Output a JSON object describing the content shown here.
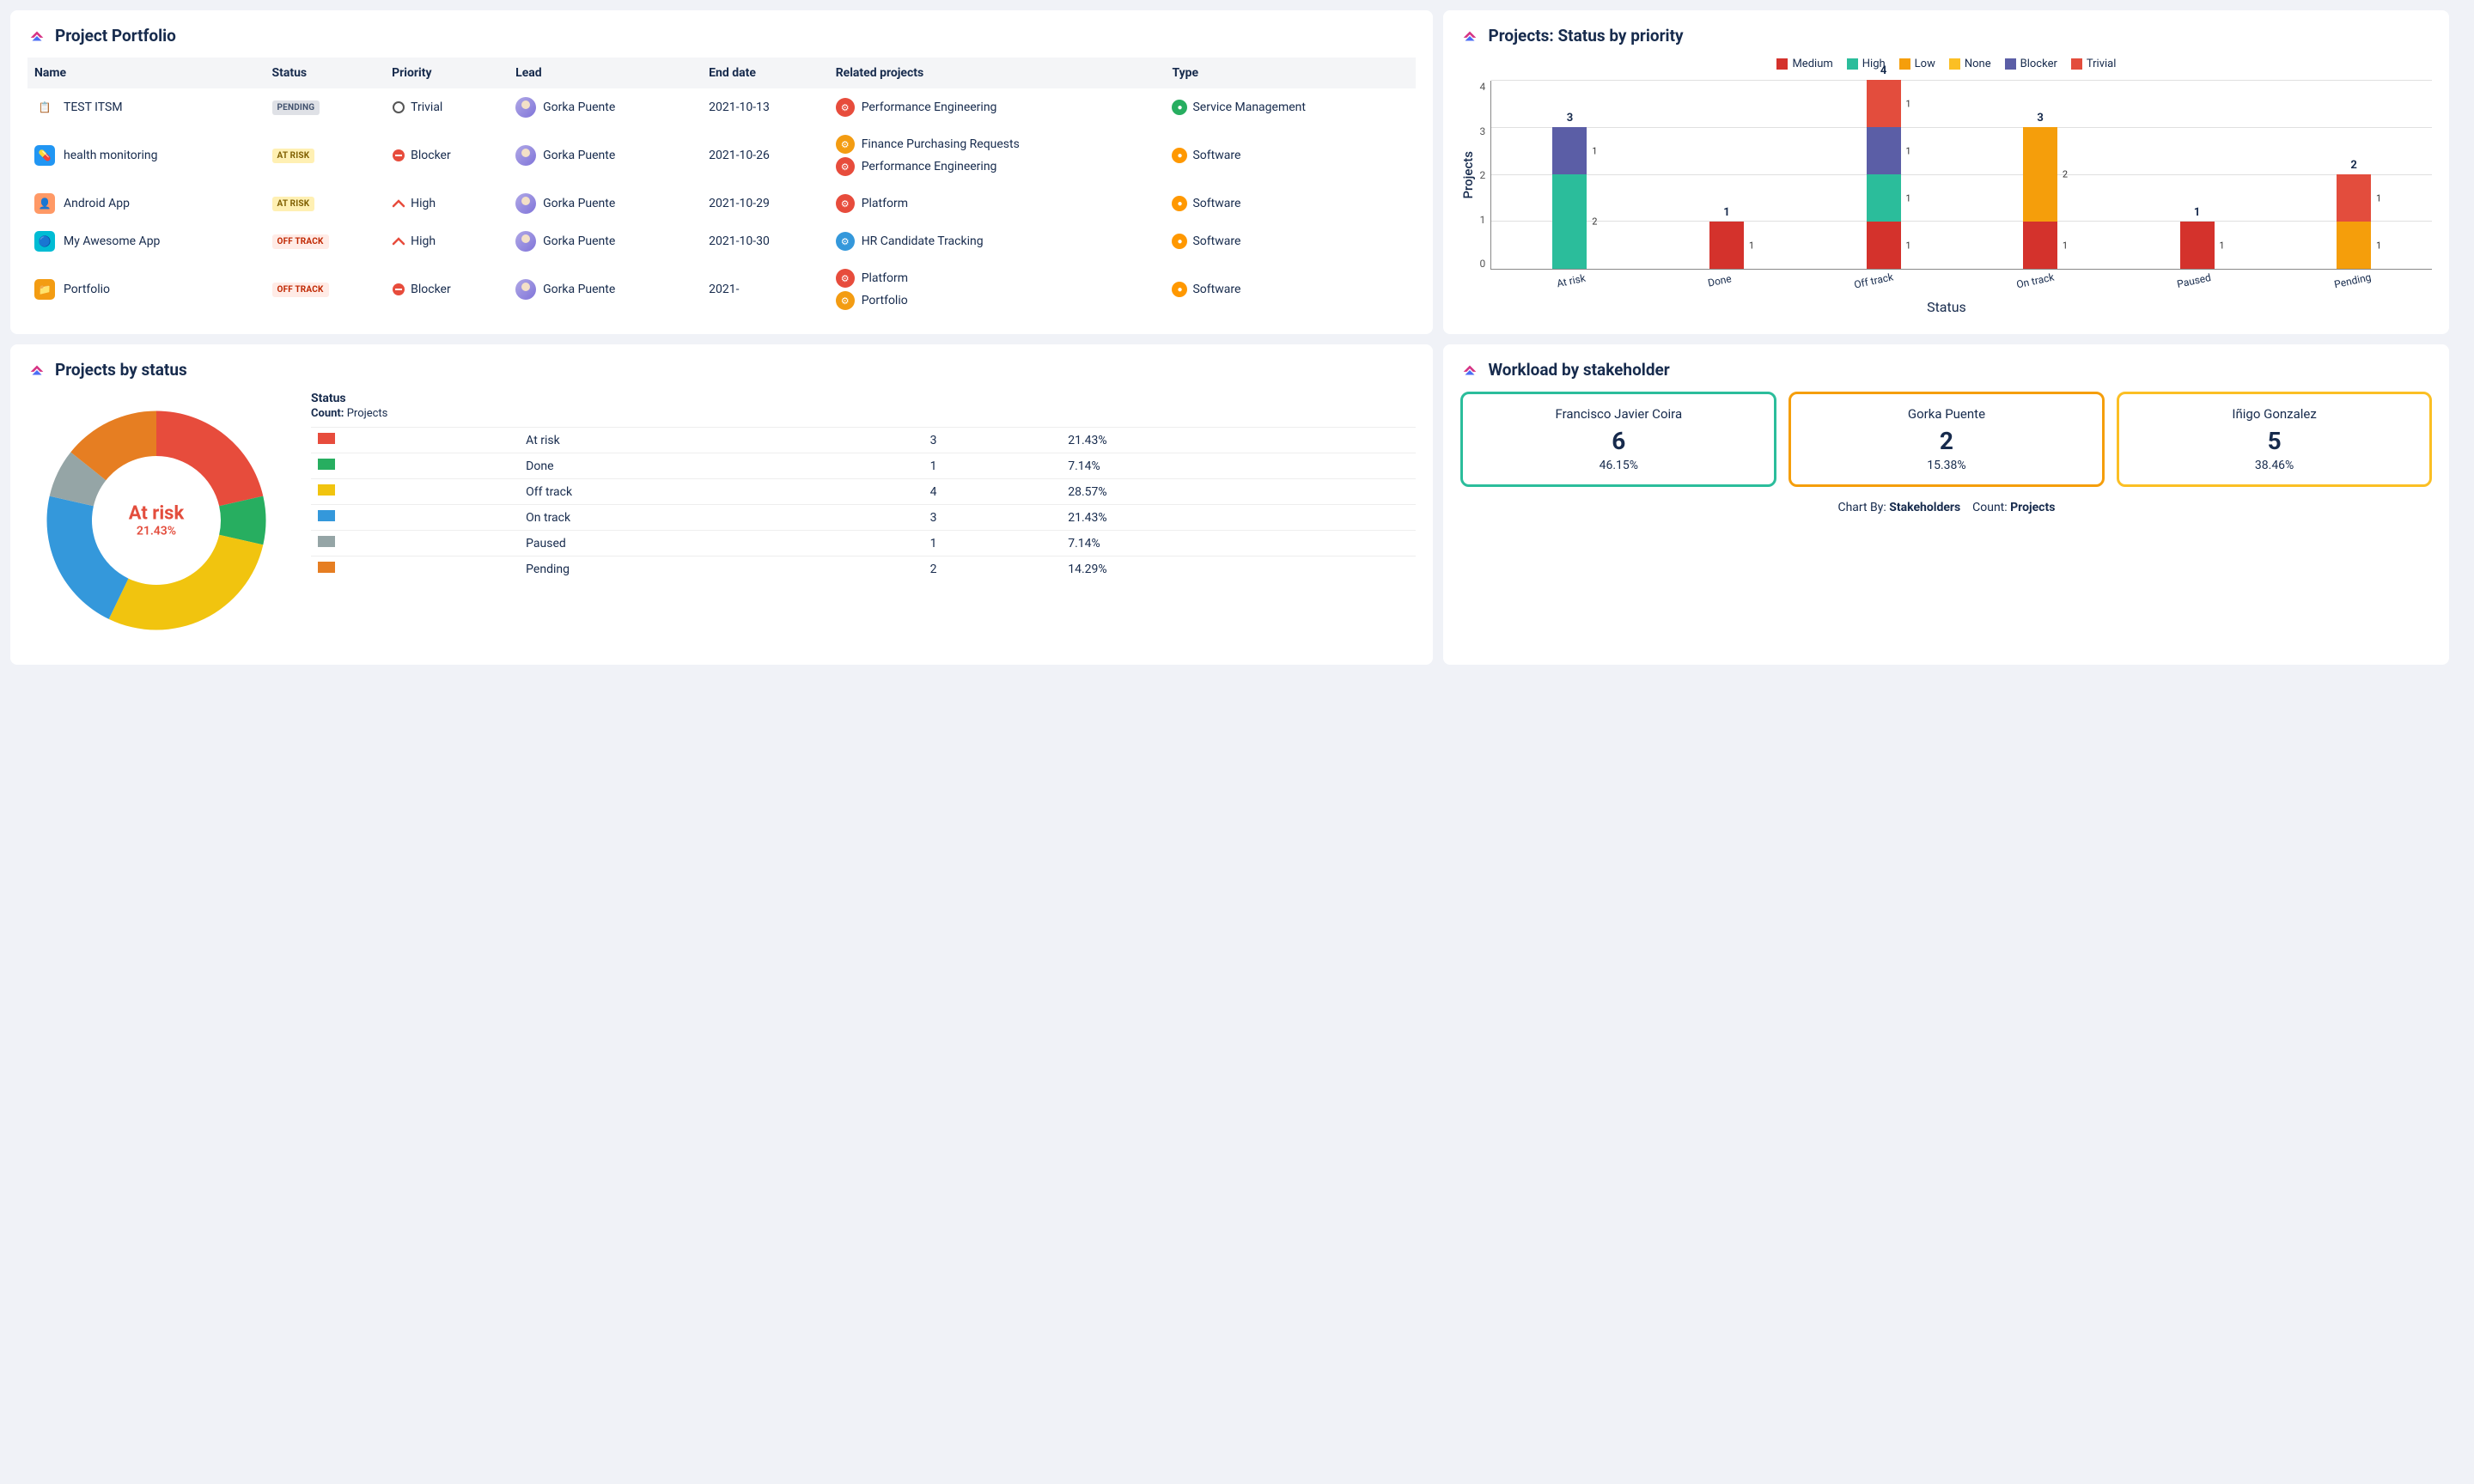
{
  "colors": {
    "medium": "#d4322c",
    "high": "#2bbd9b",
    "low": "#f59e0b",
    "none": "#fbbf24",
    "blocker": "#5b5ea6",
    "trivial": "#e34d3d",
    "pieAtrisk": "#e74c3c",
    "pieDone": "#27ae60",
    "pieOfftrack": "#f1c40f",
    "pieOntrack": "#3498db",
    "piePaused": "#95a5a6",
    "piePending": "#e67e22"
  },
  "portfolio": {
    "title": "Project Portfolio",
    "columns": [
      "Name",
      "Status",
      "Priority",
      "Lead",
      "End date",
      "Related projects",
      "Type"
    ],
    "rows": [
      {
        "icon_bg": "#fff",
        "icon_emoji": "📋",
        "name": "TEST ITSM",
        "status": "PENDING",
        "status_cls": "status-pending",
        "priority": "Trivial",
        "pri_icon": "circle",
        "lead": "Gorka Puente",
        "end": "2021-10-13",
        "related": [
          {
            "icon_bg": "#e74c3c",
            "label": "Performance Engineering"
          }
        ],
        "type": "Service Management",
        "type_bg": "#27ae60"
      },
      {
        "icon_bg": "#2196f3",
        "icon_emoji": "💊",
        "name": "health monitoring",
        "status": "AT RISK",
        "status_cls": "status-atrisk",
        "priority": "Blocker",
        "pri_icon": "blocker",
        "lead": "Gorka Puente",
        "end": "2021-10-26",
        "related": [
          {
            "icon_bg": "#f39c12",
            "label": "Finance Purchasing Requests"
          },
          {
            "icon_bg": "#e74c3c",
            "label": "Performance Engineering"
          }
        ],
        "type": "Software",
        "type_bg": "#ff9800"
      },
      {
        "icon_bg": "#ff9966",
        "icon_emoji": "👤",
        "name": "Android App",
        "status": "AT RISK",
        "status_cls": "status-atrisk",
        "priority": "High",
        "pri_icon": "high",
        "lead": "Gorka Puente",
        "end": "2021-10-29",
        "related": [
          {
            "icon_bg": "#e74c3c",
            "label": "Platform"
          }
        ],
        "type": "Software",
        "type_bg": "#ff9800"
      },
      {
        "icon_bg": "#00bcd4",
        "icon_emoji": "🔵",
        "name": "My Awesome App",
        "status": "OFF TRACK",
        "status_cls": "status-offtrack",
        "priority": "High",
        "pri_icon": "high",
        "lead": "Gorka Puente",
        "end": "2021-10-30",
        "related": [
          {
            "icon_bg": "#3498db",
            "label": "HR Candidate Tracking"
          }
        ],
        "type": "Software",
        "type_bg": "#ff9800"
      },
      {
        "icon_bg": "#f39c12",
        "icon_emoji": "📁",
        "name": "Portfolio",
        "status": "OFF TRACK",
        "status_cls": "status-offtrack",
        "priority": "Blocker",
        "pri_icon": "blocker",
        "lead": "Gorka Puente",
        "end": "2021-",
        "related": [
          {
            "icon_bg": "#e74c3c",
            "label": "Platform"
          },
          {
            "icon_bg": "#f39c12",
            "label": "Portfolio"
          }
        ],
        "type": "Software",
        "type_bg": "#ff9800"
      }
    ]
  },
  "statusByPriority": {
    "title": "Projects: Status by priority",
    "legend": [
      "Medium",
      "High",
      "Low",
      "None",
      "Blocker",
      "Trivial"
    ],
    "ylabel": "Projects",
    "xlabel": "Status",
    "ymax": 4,
    "categories": [
      "At risk",
      "Done",
      "Off track",
      "On track",
      "Paused",
      "Pending"
    ],
    "stacks": [
      {
        "total": 3,
        "segs": [
          {
            "k": "High",
            "v": 2
          },
          {
            "k": "Blocker",
            "v": 1
          }
        ]
      },
      {
        "total": 1,
        "segs": [
          {
            "k": "Medium",
            "v": 1
          }
        ]
      },
      {
        "total": 4,
        "segs": [
          {
            "k": "Medium",
            "v": 1
          },
          {
            "k": "High",
            "v": 1
          },
          {
            "k": "Blocker",
            "v": 1
          },
          {
            "k": "Trivial",
            "v": 1
          }
        ]
      },
      {
        "total": 3,
        "segs": [
          {
            "k": "Medium",
            "v": 1
          },
          {
            "k": "Low",
            "v": 2
          }
        ]
      },
      {
        "total": 1,
        "segs": [
          {
            "k": "Medium",
            "v": 1
          }
        ]
      },
      {
        "total": 2,
        "segs": [
          {
            "k": "Low",
            "v": 1
          },
          {
            "k": "Trivial",
            "v": 1
          }
        ]
      }
    ]
  },
  "projectsByStatus": {
    "title": "Projects by status",
    "center_label": "At risk",
    "center_pct": "21.43%",
    "legend_title": "Status",
    "legend_sub_label": "Count:",
    "legend_sub_value": "Projects",
    "rows": [
      {
        "k": "At risk",
        "count": 3,
        "pct": "21.43%",
        "color": "pieAtrisk"
      },
      {
        "k": "Done",
        "count": 1,
        "pct": "7.14%",
        "color": "pieDone"
      },
      {
        "k": "Off track",
        "count": 4,
        "pct": "28.57%",
        "color": "pieOfftrack"
      },
      {
        "k": "On track",
        "count": 3,
        "pct": "21.43%",
        "color": "pieOntrack"
      },
      {
        "k": "Paused",
        "count": 1,
        "pct": "7.14%",
        "color": "piePaused"
      },
      {
        "k": "Pending",
        "count": 2,
        "pct": "14.29%",
        "color": "piePending"
      }
    ]
  },
  "workload": {
    "title": "Workload by stakeholder",
    "cards": [
      {
        "name": "Francisco Javier Coira",
        "count": 6,
        "pct": "46.15%",
        "border": "#2bbd9b"
      },
      {
        "name": "Gorka Puente",
        "count": 2,
        "pct": "15.38%",
        "border": "#f59e0b"
      },
      {
        "name": "Iñigo Gonzalez",
        "count": 5,
        "pct": "38.46%",
        "border": "#fbbf24"
      }
    ],
    "footer_label1": "Chart By:",
    "footer_val1": "Stakeholders",
    "footer_label2": "Count:",
    "footer_val2": "Projects"
  },
  "chart_data": [
    {
      "type": "bar",
      "stacked": true,
      "title": "Projects: Status by priority",
      "xlabel": "Status",
      "ylabel": "Projects",
      "ylim": [
        0,
        4
      ],
      "categories": [
        "At risk",
        "Done",
        "Off track",
        "On track",
        "Paused",
        "Pending"
      ],
      "series": [
        {
          "name": "Medium",
          "values": [
            0,
            1,
            1,
            1,
            1,
            0
          ]
        },
        {
          "name": "High",
          "values": [
            2,
            0,
            1,
            0,
            0,
            0
          ]
        },
        {
          "name": "Low",
          "values": [
            0,
            0,
            0,
            2,
            0,
            1
          ]
        },
        {
          "name": "None",
          "values": [
            0,
            0,
            0,
            0,
            0,
            0
          ]
        },
        {
          "name": "Blocker",
          "values": [
            1,
            0,
            1,
            0,
            0,
            0
          ]
        },
        {
          "name": "Trivial",
          "values": [
            0,
            0,
            1,
            0,
            0,
            1
          ]
        }
      ]
    },
    {
      "type": "pie",
      "donut": true,
      "title": "Projects by status",
      "categories": [
        "At risk",
        "Done",
        "Off track",
        "On track",
        "Paused",
        "Pending"
      ],
      "values": [
        3,
        1,
        4,
        3,
        1,
        2
      ],
      "percentages": [
        21.43,
        7.14,
        28.57,
        21.43,
        7.14,
        14.29
      ]
    },
    {
      "type": "table",
      "title": "Workload by stakeholder",
      "categories": [
        "Francisco Javier Coira",
        "Gorka Puente",
        "Iñigo Gonzalez"
      ],
      "values": [
        6,
        2,
        5
      ],
      "percentages": [
        46.15,
        15.38,
        38.46
      ]
    }
  ]
}
